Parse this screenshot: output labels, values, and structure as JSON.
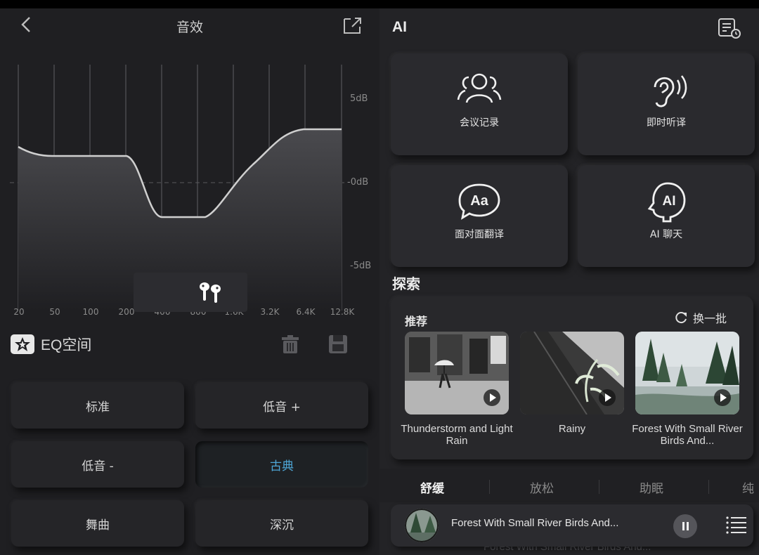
{
  "left": {
    "title": "音效",
    "db_labels": [
      "5dB",
      "-0dB",
      "-5dB"
    ],
    "freq_labels": [
      "20",
      "50",
      "100",
      "200",
      "400",
      "800",
      "1.6K",
      "3.2K",
      "6.4K",
      "12.8K"
    ],
    "eq_space_label": "EQ空间",
    "presets": [
      "标准",
      "低音 +",
      "低音 -",
      "古典",
      "舞曲",
      "深沉"
    ],
    "active_preset": "古典",
    "accent_color": "#4ea6d6"
  },
  "right": {
    "title": "AI",
    "features": [
      "会议记录",
      "即时听译",
      "面对面翻译",
      "AI 聊天"
    ],
    "explore_heading": "探索",
    "recommend": {
      "title": "推荐",
      "refresh_label": "换一批",
      "items": [
        {
          "title": "Thunderstorm and Light Rain"
        },
        {
          "title": "Rainy"
        },
        {
          "title": "Forest With Small River Birds And..."
        }
      ]
    },
    "tabs": [
      "舒缓",
      "放松",
      "助眠",
      "纯"
    ],
    "active_tab": "舒缓",
    "now_playing": {
      "title": "Forest With Small River Birds And...",
      "ghost_title": "Forest With Small River Birds And..."
    }
  }
}
